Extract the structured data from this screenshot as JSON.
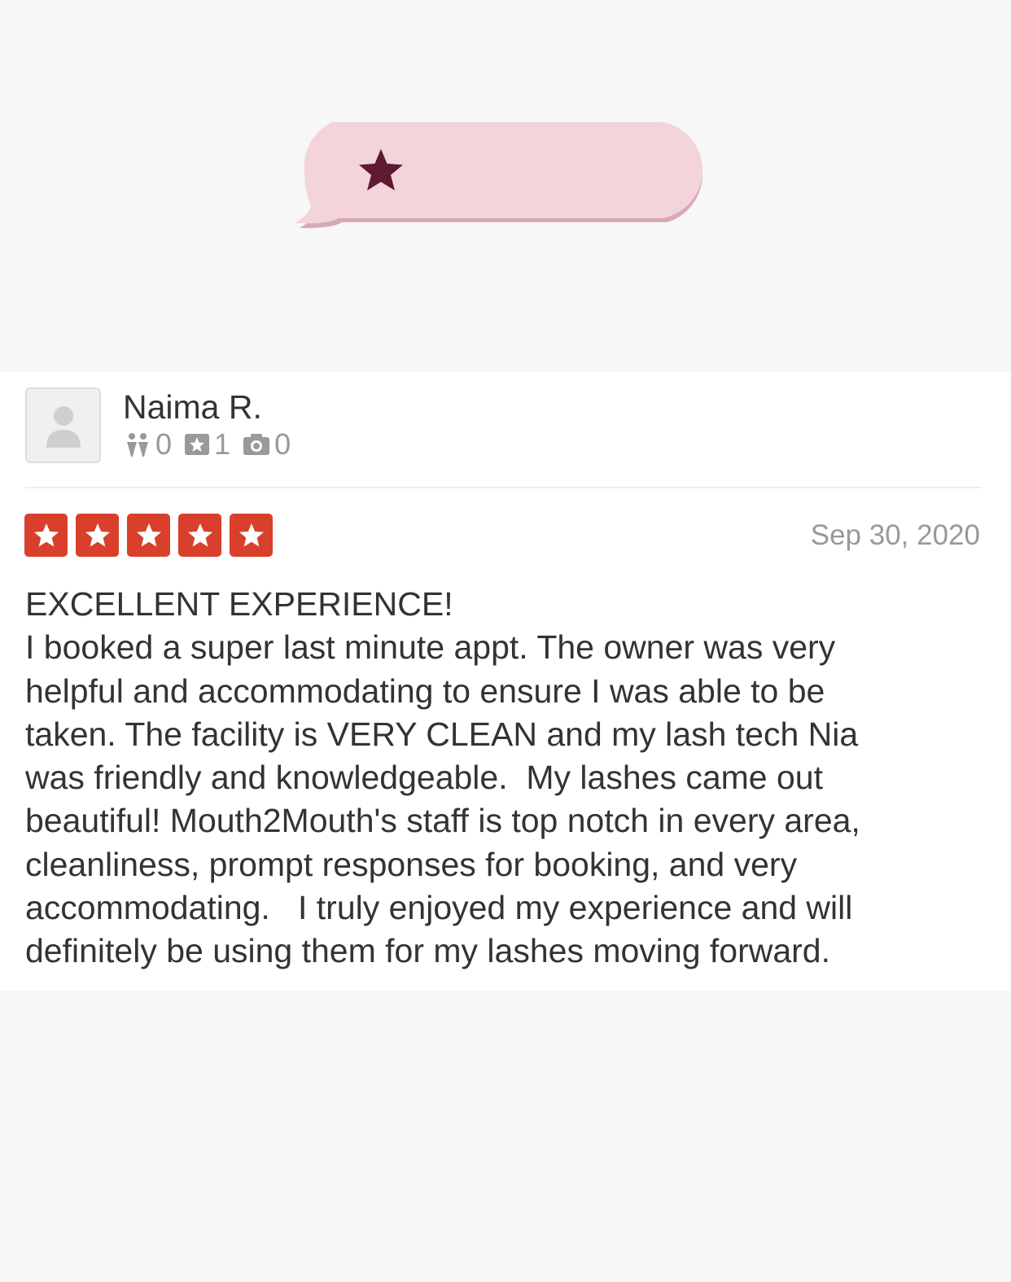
{
  "review": {
    "reviewer_name": "Naima R.",
    "stats": {
      "friends": "0",
      "reviews": "1",
      "photos": "0"
    },
    "rating": 5,
    "date": "Sep 30, 2020",
    "title": "EXCELLENT EXPERIENCE!",
    "text": "I booked a super last minute appt. The owner was very\nhelpful and accommodating to ensure I was able to be\ntaken. The facility is VERY CLEAN and my lash tech Nia\nwas friendly and knowledgeable.  My lashes came out\nbeautiful! Mouth2Mouth's staff is top notch in every area,\ncleanliness, prompt responses for booking, and very\naccommodating.   I truly enjoyed my experience and will\ndefinitely be using them for my lashes moving forward."
  },
  "icons": {
    "bubble": "star-speech-bubble-icon",
    "avatar": "default-user-icon",
    "friends": "friends-icon",
    "reviews": "review-star-icon",
    "photos": "camera-icon",
    "rating_star": "star-icon"
  },
  "colors": {
    "bubble_fill": "#f2d4da",
    "bubble_shadow": "#d9a8b4",
    "bubble_star": "#5e1a30",
    "rating_red": "#d9402b",
    "text": "#333333",
    "muted": "#999999"
  }
}
